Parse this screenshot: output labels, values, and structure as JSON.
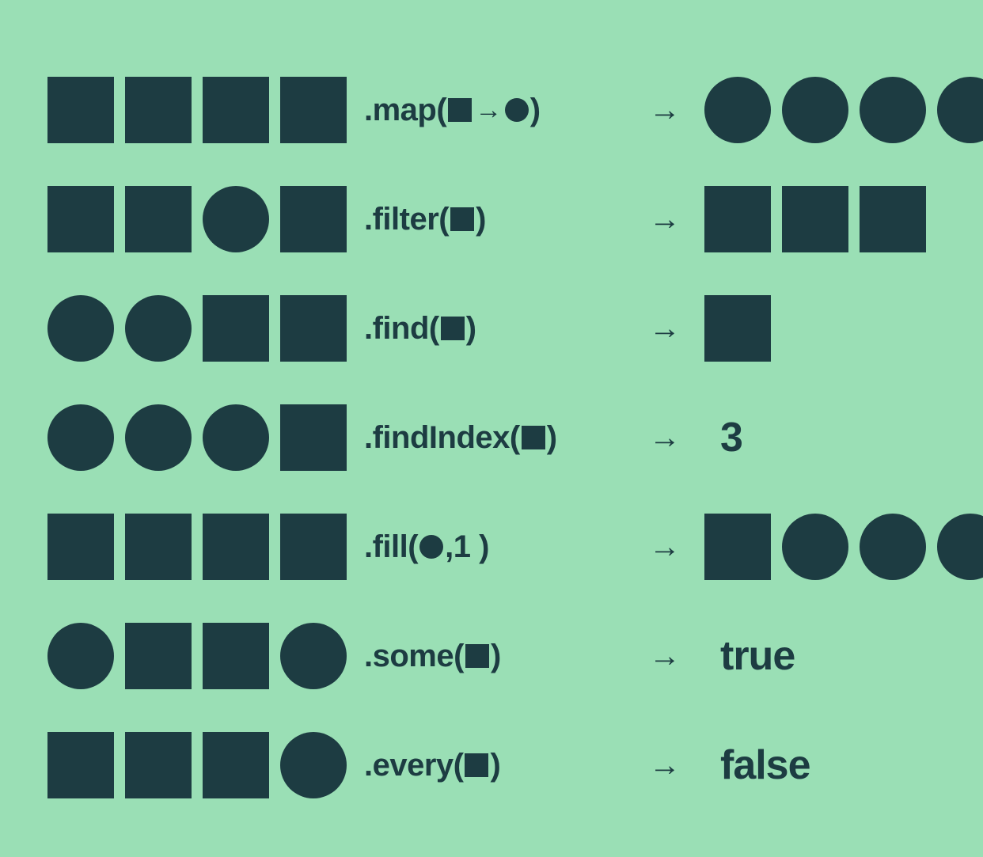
{
  "colors": {
    "bg": "#9adfb5",
    "fg": "#1d3c42"
  },
  "arrow": "→",
  "rows": [
    {
      "input": [
        "square",
        "square",
        "square",
        "square"
      ],
      "method": {
        "parts": [
          ".map(",
          {
            "shape": "square"
          },
          {
            "arrow": true
          },
          {
            "shape": "circle"
          },
          ")"
        ]
      },
      "output": {
        "shapes": [
          "circle",
          "circle",
          "circle",
          "circle"
        ]
      }
    },
    {
      "input": [
        "square",
        "square",
        "circle",
        "square"
      ],
      "method": {
        "parts": [
          ".filter(",
          {
            "shape": "square"
          },
          ")"
        ]
      },
      "output": {
        "shapes": [
          "square",
          "square",
          "square"
        ]
      }
    },
    {
      "input": [
        "circle",
        "circle",
        "square",
        "square"
      ],
      "method": {
        "parts": [
          ".find(",
          {
            "shape": "square"
          },
          ")"
        ]
      },
      "output": {
        "shapes": [
          "square"
        ]
      }
    },
    {
      "input": [
        "circle",
        "circle",
        "circle",
        "square"
      ],
      "method": {
        "parts": [
          ".findIndex(",
          {
            "shape": "square"
          },
          ")"
        ]
      },
      "output": {
        "text": "3"
      }
    },
    {
      "input": [
        "square",
        "square",
        "square",
        "square"
      ],
      "method": {
        "parts": [
          ".fill(",
          {
            "shape": "circle"
          },
          ",1 )"
        ]
      },
      "output": {
        "shapes": [
          "square",
          "circle",
          "circle",
          "circle"
        ]
      }
    },
    {
      "input": [
        "circle",
        "square",
        "square",
        "circle"
      ],
      "method": {
        "parts": [
          ".some(",
          {
            "shape": "square"
          },
          ")"
        ]
      },
      "output": {
        "text": "true"
      }
    },
    {
      "input": [
        "square",
        "square",
        "square",
        "circle"
      ],
      "method": {
        "parts": [
          ".every(",
          {
            "shape": "square"
          },
          ")"
        ]
      },
      "output": {
        "text": "false"
      }
    }
  ]
}
